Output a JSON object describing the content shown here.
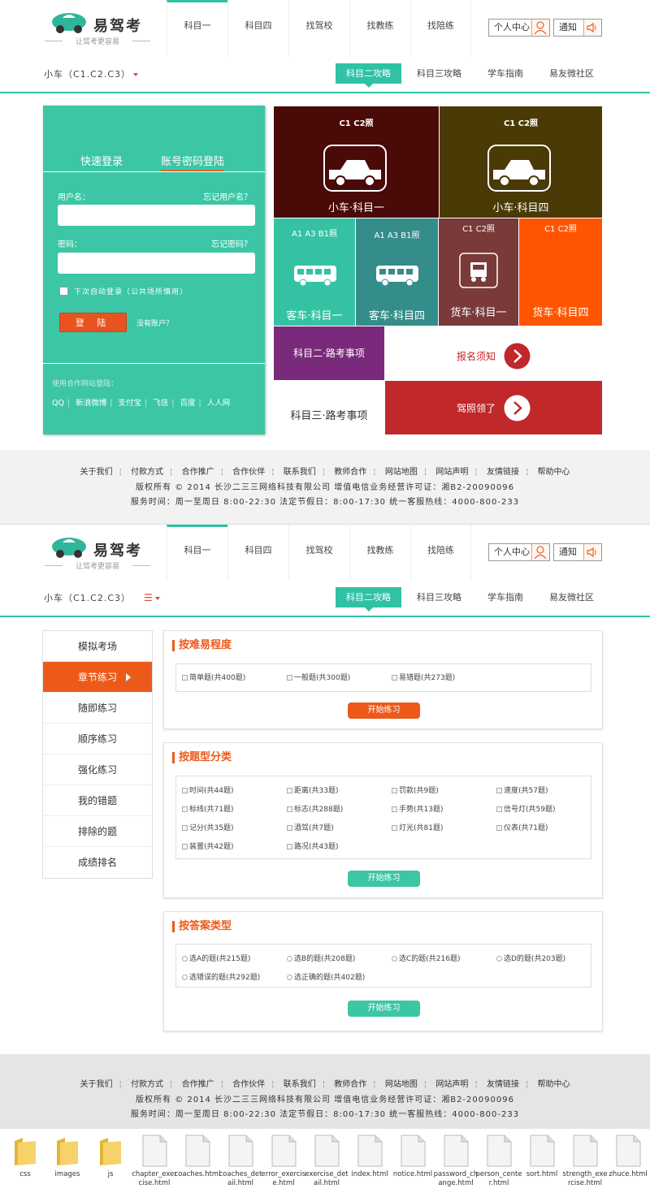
{
  "brand": {
    "name": "易驾考",
    "slogan": "让驾考更容易",
    "accent": "#2fc2a4",
    "orange": "#ec5a1a"
  },
  "nav": {
    "items": [
      "科目一",
      "科目四",
      "找驾校",
      "找教练",
      "找陪练"
    ],
    "user_center": "个人中心",
    "notify": "通知"
  },
  "subbar": {
    "car_type": "小车（C1.C2.C3）",
    "tabs": [
      "科目二攻略",
      "科目三攻略",
      "学车指南",
      "易友微社区"
    ]
  },
  "login": {
    "tab_quick": "快速登录",
    "tab_account": "账号密码登陆",
    "username_label": "用户名：",
    "forgot_username": "忘记用户名？",
    "password_label": "密码：",
    "forgot_password": "忘记密码？",
    "remember": "下次自动登录（公共场所慎用）",
    "login_btn": "登 陆",
    "no_account": "没有账户？",
    "partner_label": "使用合作网站登陆：",
    "partners": [
      "QQ",
      "新浪微博",
      "支付宝",
      "飞信",
      "百度",
      "人人网"
    ]
  },
  "tiles": {
    "t1": {
      "top": "C1 C2照",
      "bottom": "小车·科目一",
      "color": "#4a0a08"
    },
    "t2": {
      "top": "C1 C2照",
      "bottom": "小车·科目四",
      "color": "#4a3a06"
    },
    "t3": {
      "top": "A1 A3 B1照",
      "bottom": "客车·科目一",
      "color": "#35c2a3"
    },
    "t4": {
      "top": "A1 A3 B1照",
      "bottom": "客车·科目四",
      "color": "#358d8a"
    },
    "t5": {
      "top": "C1 C2照",
      "bottom": "货车·科目一",
      "color": "#7a3a3a"
    },
    "t6": {
      "top": "C1 C2照",
      "bottom": "货车·科目四",
      "color": "#ff5500"
    },
    "t7": {
      "label": "科目二·路考事项",
      "color": "#7a2a7a"
    },
    "t8": {
      "label": "报名须知",
      "color": "#c0282a"
    },
    "t9": {
      "label": "科目三·路考事项"
    },
    "t10": {
      "label": "驾照领了",
      "color": "#c0282a"
    }
  },
  "footer": {
    "links": [
      "关于我们",
      "付款方式",
      "合作推广",
      "合作伙伴",
      "联系我们",
      "教师合作",
      "网站地图",
      "网站声明",
      "友情链接",
      "帮助中心"
    ],
    "copyright": "版权所有 © 2014 长沙二三三网络科技有限公司    增值电信业务经营许可证：湘B2-20090096",
    "service": "服务时间：周一至周日 8:00-22:30 法定节假日：8:00-17:30 统一客服热线：4000-800-233"
  },
  "side": {
    "items": [
      "模拟考场",
      "章节练习",
      "随即练习",
      "顺序练习",
      "强化练习",
      "我的错题",
      "排除的题",
      "成绩排名"
    ]
  },
  "panels": {
    "p1": {
      "title": "按难易程度",
      "options": [
        "简单题(共400题)",
        "一般题(共300题)",
        "易错题(共273题)"
      ],
      "button": "开始练习"
    },
    "p2": {
      "title": "按题型分类",
      "options": [
        "时间(共44题)",
        "距离(共33题)",
        "罚款(共9题)",
        "速度(共57题)",
        "标线(共71题)",
        "标志(共288题)",
        "手势(共13题)",
        "信号灯(共59题)",
        "记分(共35题)",
        "酒驾(共7题)",
        "灯光(共81题)",
        "仪表(共71题)",
        "装置(共42题)",
        "路况(共43题)"
      ],
      "button": "开始练习"
    },
    "p3": {
      "title": "按答案类型",
      "options": [
        "选A的题(共215题)",
        "选B的题(共208题)",
        "选C的题(共216题)",
        "选D的题(共203题)",
        "选错误的题(共292题)",
        "选正确的题(共402题)"
      ],
      "button": "开始练习"
    }
  },
  "files": [
    "css",
    "images",
    "js",
    "chapter_exercise.html",
    "coaches.html",
    "coaches_detail.html",
    "error_exercise.html",
    "exercise_detail.html",
    "index.html",
    "notice.html",
    "password_change.html",
    "person_center.html",
    "sort.html",
    "strength_exercise.html",
    "zhuce.html"
  ]
}
